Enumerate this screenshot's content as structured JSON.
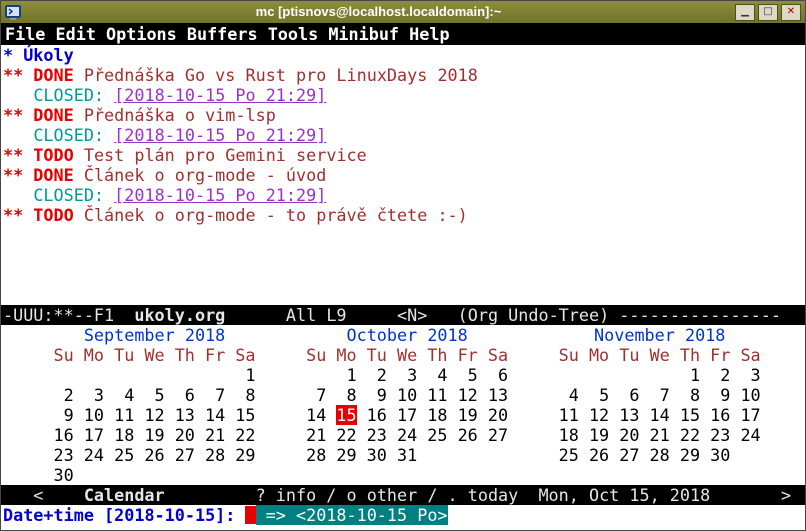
{
  "window": {
    "title": "mc [ptisnovs@localhost.localdomain]:~"
  },
  "icons": {
    "window_icon": "terminal-icon",
    "minimize_icon": "▁",
    "maximize_icon": "□",
    "close_icon": "✕"
  },
  "menubar": {
    "items": [
      "File",
      "Edit",
      "Options",
      "Buffers",
      "Tools",
      "Minibuf",
      "Help"
    ]
  },
  "buffer": {
    "lines": [
      [
        {
          "t": "* Úkoly",
          "c": "lvl1"
        }
      ],
      [
        {
          "t": "** DONE",
          "c": "todo"
        },
        {
          "t": " Přednáška Go vs Rust pro LinuxDays 2018",
          "c": "hl2"
        }
      ],
      [
        {
          "t": "   ",
          "c": "plain"
        },
        {
          "t": "CLOSED:",
          "c": "kw"
        },
        {
          "t": " ",
          "c": "plain"
        },
        {
          "t": "[2018-10-15 Po 21:29]",
          "c": "date"
        }
      ],
      [
        {
          "t": "** DONE",
          "c": "todo"
        },
        {
          "t": " Přednáška o vim-lsp",
          "c": "hl2"
        }
      ],
      [
        {
          "t": "   ",
          "c": "plain"
        },
        {
          "t": "CLOSED:",
          "c": "kw"
        },
        {
          "t": " ",
          "c": "plain"
        },
        {
          "t": "[2018-10-15 Po 21:29]",
          "c": "date"
        }
      ],
      [
        {
          "t": "** TODO",
          "c": "todo"
        },
        {
          "t": " Test plán pro Gemini service",
          "c": "hl2"
        }
      ],
      [
        {
          "t": "** DONE",
          "c": "todo"
        },
        {
          "t": " Článek o org-mode - úvod",
          "c": "hl2"
        }
      ],
      [
        {
          "t": "   ",
          "c": "plain"
        },
        {
          "t": "CLOSED:",
          "c": "kw"
        },
        {
          "t": " ",
          "c": "plain"
        },
        {
          "t": "[2018-10-15 Po 21:29]",
          "c": "date"
        }
      ],
      [
        {
          "t": "** TODO",
          "c": "todo"
        },
        {
          "t": " Článek o org-mode - to právě čtete :-)",
          "c": "hl2"
        }
      ]
    ]
  },
  "modeline": {
    "prefix": "-UUU:**--F1  ",
    "buffer_name": "ukoly.org",
    "suffix": "      All L9     <N>   (Org Undo-Tree) ----------------"
  },
  "calendar": {
    "day_headers": [
      "Su",
      "Mo",
      "Tu",
      "We",
      "Th",
      "Fr",
      "Sa"
    ],
    "months": [
      {
        "name": "September 2018",
        "weeks": [
          [
            "",
            "",
            "",
            "",
            "",
            "",
            "1"
          ],
          [
            "2",
            "3",
            "4",
            "5",
            "6",
            "7",
            "8"
          ],
          [
            "9",
            "10",
            "11",
            "12",
            "13",
            "14",
            "15"
          ],
          [
            "16",
            "17",
            "18",
            "19",
            "20",
            "21",
            "22"
          ],
          [
            "23",
            "24",
            "25",
            "26",
            "27",
            "28",
            "29"
          ],
          [
            "30",
            "",
            "",
            "",
            "",
            "",
            ""
          ]
        ]
      },
      {
        "name": "October 2018",
        "weeks": [
          [
            "",
            "1",
            "2",
            "3",
            "4",
            "5",
            "6"
          ],
          [
            "7",
            "8",
            "9",
            "10",
            "11",
            "12",
            "13"
          ],
          [
            "14",
            "15",
            "16",
            "17",
            "18",
            "19",
            "20"
          ],
          [
            "21",
            "22",
            "23",
            "24",
            "25",
            "26",
            "27"
          ],
          [
            "28",
            "29",
            "30",
            "31",
            "",
            "",
            ""
          ]
        ]
      },
      {
        "name": "November 2018",
        "weeks": [
          [
            "",
            "",
            "",
            "",
            "1",
            "2",
            "3"
          ],
          [
            "4",
            "5",
            "6",
            "7",
            "8",
            "9",
            "10"
          ],
          [
            "11",
            "12",
            "13",
            "14",
            "15",
            "16",
            "17"
          ],
          [
            "18",
            "19",
            "20",
            "21",
            "22",
            "23",
            "24"
          ],
          [
            "25",
            "26",
            "27",
            "28",
            "29",
            "30",
            ""
          ]
        ]
      }
    ],
    "today": {
      "month_index": 1,
      "day": "15"
    }
  },
  "calendar_modeline": {
    "back": "<",
    "title": "Calendar",
    "help": "? info / o other / . today",
    "date": "Mon, Oct 15, 2018",
    "forward": ">"
  },
  "minibuffer": {
    "prompt": "Date+time [2018-10-15]: ",
    "completion": "=> <2018-10-15 Po>"
  },
  "colors": {
    "titlebar_bg": "#737329",
    "titlebar_bg_light": "#8d8d3f",
    "menubar_bg": "#000000",
    "menubar_fg": "#ffffff",
    "buffer_bg": "#ffffff",
    "level1_blue": "#0000cd",
    "todo_red": "#e60000",
    "headline_maroon": "#a03030",
    "closed_cyan": "#009a9a",
    "date_purple": "#9932cc",
    "modeline_bg": "#000000",
    "modeline_fg": "#e6e6e6",
    "month_blue": "#0033cc",
    "weekday_brown": "#a03030",
    "day_fg": "#000000",
    "today_bg": "#e60000",
    "today_fg": "#ffffff",
    "prompt_blue": "#0000cd",
    "cursor_red": "#e60000",
    "completion_bg": "#008080",
    "completion_fg": "#ffffff"
  }
}
